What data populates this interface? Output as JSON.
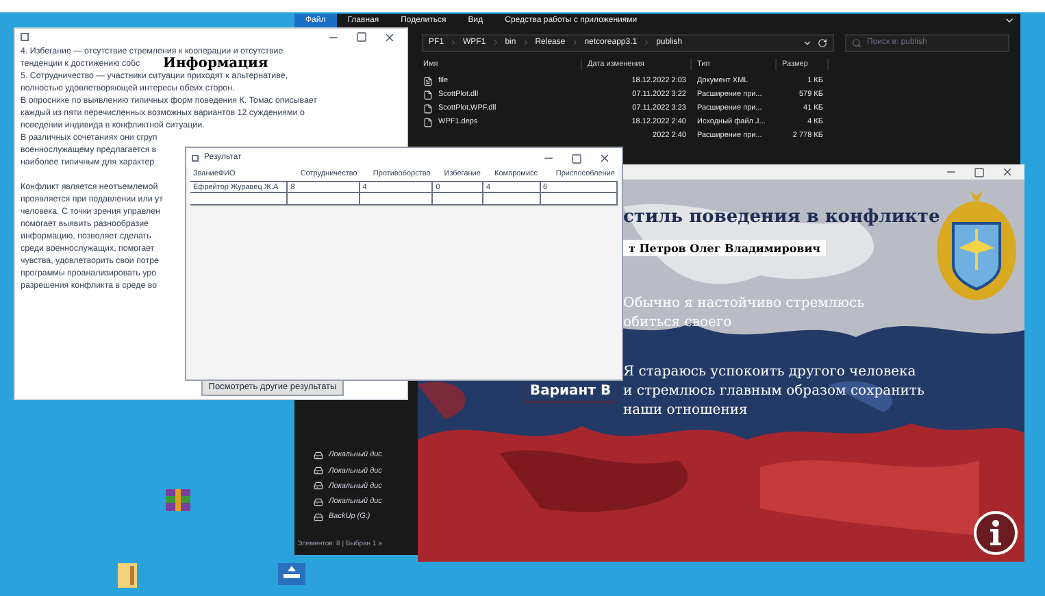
{
  "explorer": {
    "ribbon_tabs": [
      {
        "label": "Файл",
        "selected": true
      },
      {
        "label": "Главная",
        "selected": false
      },
      {
        "label": "Поделиться",
        "selected": false
      },
      {
        "label": "Вид",
        "selected": false
      },
      {
        "label": "Средства работы с приложениями",
        "selected": false
      }
    ],
    "path": [
      "PF1",
      "WPF1",
      "bin",
      "Release",
      "netcoreapp3.1",
      "publish"
    ],
    "search": {
      "placeholder": "Поиск в: publish"
    },
    "columns": [
      "Имя",
      "Дата изменения",
      "Тип",
      "Размер"
    ],
    "rows": [
      {
        "name": "file",
        "date": "18.12.2022 2:03",
        "type": "Документ XML",
        "size": "1 КБ"
      },
      {
        "name": "ScottPlot.dll",
        "date": "07.11.2022 3:22",
        "type": "Расширение при...",
        "size": "579 КБ"
      },
      {
        "name": "ScottPlot.WPF.dll",
        "date": "07.11.2022 3:23",
        "type": "Расширение при...",
        "size": "41 КБ"
      },
      {
        "name": "WPF1.deps",
        "date": "18.12.2022 2:40",
        "type": "Исходный файл J...",
        "size": "4 КБ"
      },
      {
        "date": "2022 2:40",
        "type": "Расширение при...",
        "size": "2 778 КБ"
      }
    ],
    "nav": [
      "Локальный дис",
      "Локальный дис",
      "Локальный дис",
      "Локальный дис",
      "BackUp (G:)"
    ],
    "status": "Элементов: 8 | Выбран 1 э"
  },
  "info_window": {
    "heading": "Информация",
    "lines": [
      "4.         Избегание — отсутствие стремления к кооперации и отсутствие",
      "тенденции к достижению собс",
      "5.         Сотрудничество — участники ситуации приходят к альтернативе,",
      "полностью удовлетворяющей интересы обеих сторон.",
      "В опроснике по выявлению типичных форм поведения К. Томас описывает",
      "каждый из пяти перечисленных возможных вариантов 12 суждениями о",
      "поведении индивида в конфликтной ситуации.",
      "В различных сочетаниях они сгруп",
      "военнослужащему предлагается в",
      "наиболее типичным для характер",
      "Конфликт является неотъемлемой",
      "проявляется при подавлении или ут",
      "человека. С точки зрения управлен",
      "помогает выявить разнообразие",
      "информацию, позволяет сделать",
      "среди военнослужащих, помогает",
      "чувства, удовлетворить свои потре",
      "программы проанализировать уро",
      "разрешения конфликта в среде во"
    ],
    "button": "Посмотреть другие результаты"
  },
  "results_window": {
    "title": "Результат",
    "columns": [
      "ЗваниеФИО",
      "Сотрудничество",
      "Противоборство",
      "Избегание",
      "Компромисс",
      "Приспособление"
    ],
    "rows": [
      [
        "Ефрейтор Журавец Ж.А",
        "8",
        "4",
        "0",
        "4",
        "6"
      ]
    ]
  },
  "test_window": {
    "title": "стиль поведения в конфликте",
    "name": "т Петров Олег Владимирович",
    "options": [
      {
        "lines": [
          "Обычно я настойчиво стремлюсь",
          "обиться своего"
        ]
      },
      {
        "label": "Вариант В",
        "lines": [
          "Я стараюсь успокоить другого человека",
          "и стремлюсь главным образом сохранить",
          "наши отношения"
        ]
      }
    ]
  }
}
